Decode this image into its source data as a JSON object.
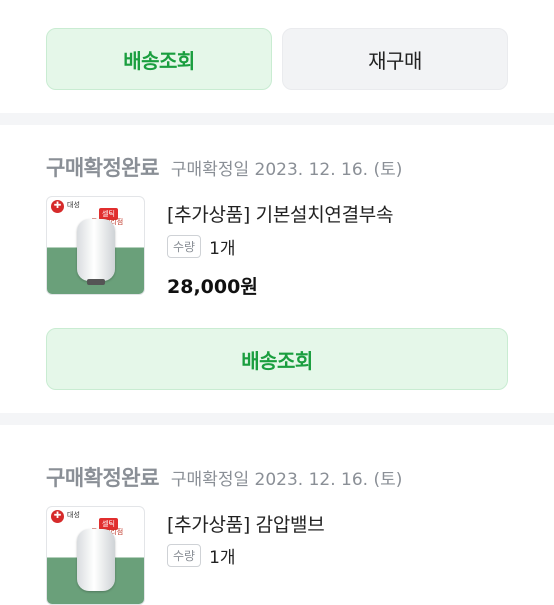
{
  "top_buttons": {
    "track": "배송조회",
    "reorder": "재구매"
  },
  "orders": [
    {
      "status": "구매확정완료",
      "confirm_date": "구매확정일 2023. 12. 16. (토)",
      "product_name": "[추가상품] 기본설치연결부속",
      "qty_label": "수량",
      "qty": "1개",
      "price": "28,000원",
      "track_button": "배송조회"
    },
    {
      "status": "구매확정완료",
      "confirm_date": "구매확정일 2023. 12. 16. (토)",
      "product_name": "[추가상품] 감압밸브",
      "qty_label": "수량",
      "qty": "1개"
    }
  ],
  "thumbnail": {
    "badge_text": "대성",
    "badge_red": "셀틱",
    "badge_official": "공식대리점"
  }
}
